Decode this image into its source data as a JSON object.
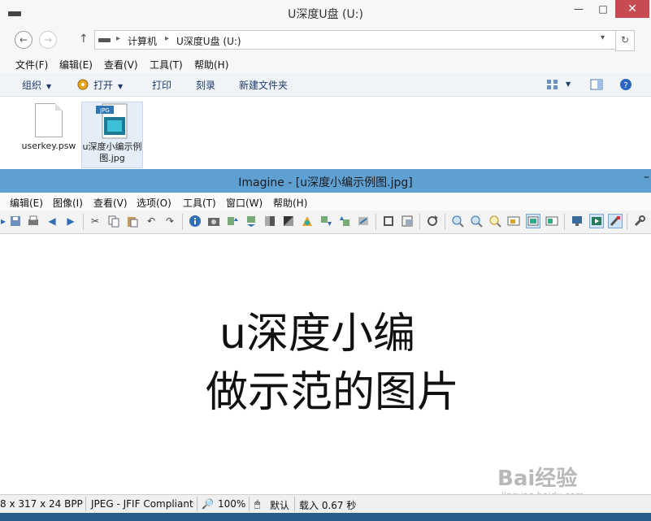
{
  "explorer": {
    "title": "U深度U盘 (U:)",
    "window_buttons": {
      "minimize": "—",
      "maximize": "□",
      "close": "✕"
    },
    "nav": {
      "back": "←",
      "forward": "→",
      "up": "↑"
    },
    "address": {
      "segments": [
        "计算机",
        "U深度U盘 (U:)"
      ],
      "separator": "▸",
      "dropdown": "▾",
      "refresh": "↻"
    },
    "menu": [
      "文件(F)",
      "编辑(E)",
      "查看(V)",
      "工具(T)",
      "帮助(H)"
    ],
    "commands": {
      "organize": "组织",
      "open": "打开",
      "print": "打印",
      "burn": "刻录",
      "new_folder": "新建文件夹"
    },
    "files": [
      {
        "name": "userkey.psw",
        "type": "generic"
      },
      {
        "name": "u深度小编示例图.jpg",
        "type": "JPG"
      }
    ]
  },
  "imagine": {
    "title": "Imagine - [u深度小编示例图.jpg]",
    "menu": [
      "编辑(E)",
      "图像(I)",
      "查看(V)",
      "选项(O)",
      "工具(T)",
      "窗口(W)",
      "帮助(H)"
    ],
    "image_text": {
      "line1": "u深度小编",
      "line2": "做示范的图片"
    },
    "watermark": {
      "brand": "Bai经验",
      "url": "jingyan.baidu.com"
    },
    "status": {
      "dims": "8 x 317 x 24 BPP",
      "format": "JPEG - JFIF Compliant",
      "zoom": "100%",
      "default": "默认",
      "load": "载入 0.67 秒"
    }
  },
  "colors": {
    "imagine_title": "#5fa0d3",
    "explorer_close": "#c74b50",
    "selection": "#e5eef8"
  }
}
